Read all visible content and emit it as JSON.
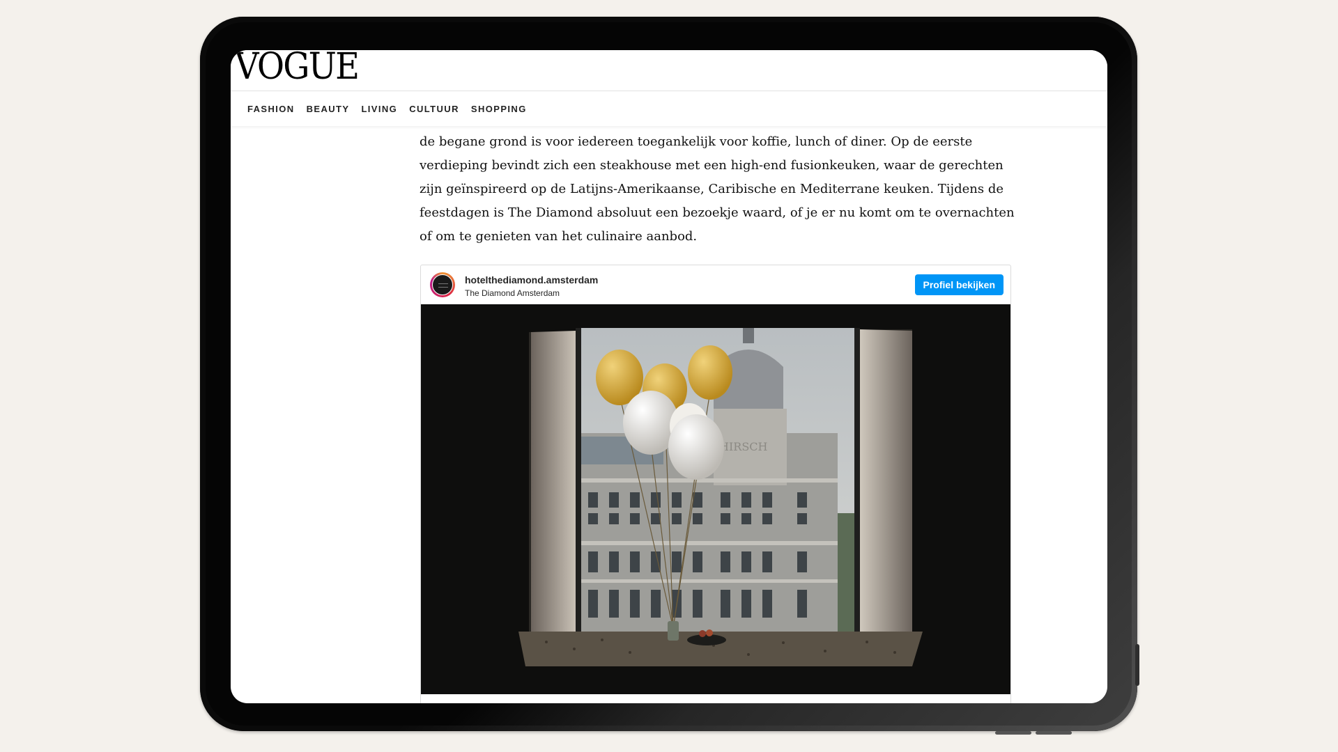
{
  "site": {
    "logo_text": "VOGUE"
  },
  "nav": {
    "items": [
      {
        "label": "FASHION"
      },
      {
        "label": "BEAUTY"
      },
      {
        "label": "LIVING"
      },
      {
        "label": "CULTUUR"
      },
      {
        "label": "SHOPPING"
      }
    ]
  },
  "article": {
    "paragraph": "de begane grond is voor iedereen toegankelijk voor koffie, lunch of diner. Op de eerste verdieping bevindt zich een steakhouse met een high-end fusionkeuken, waar de gerechten zijn geïnspireerd op de Latijns-Amerikaanse, Caribische en Mediterrane keuken. Tijdens de feestdagen is The Diamond absoluut een bezoekje waard, of je er nu komt om te overnachten of om te genieten van het culinaire aanbod."
  },
  "embed": {
    "username": "hotelthediamond.amsterdam",
    "full_name": "The Diamond Amsterdam",
    "profile_button": "Profiel bekijken",
    "photo_sign": "HIRSCH"
  },
  "colors": {
    "accent": "#0095f6",
    "balloon_gold": "#d4a935",
    "balloon_white": "#e8e6e1"
  }
}
